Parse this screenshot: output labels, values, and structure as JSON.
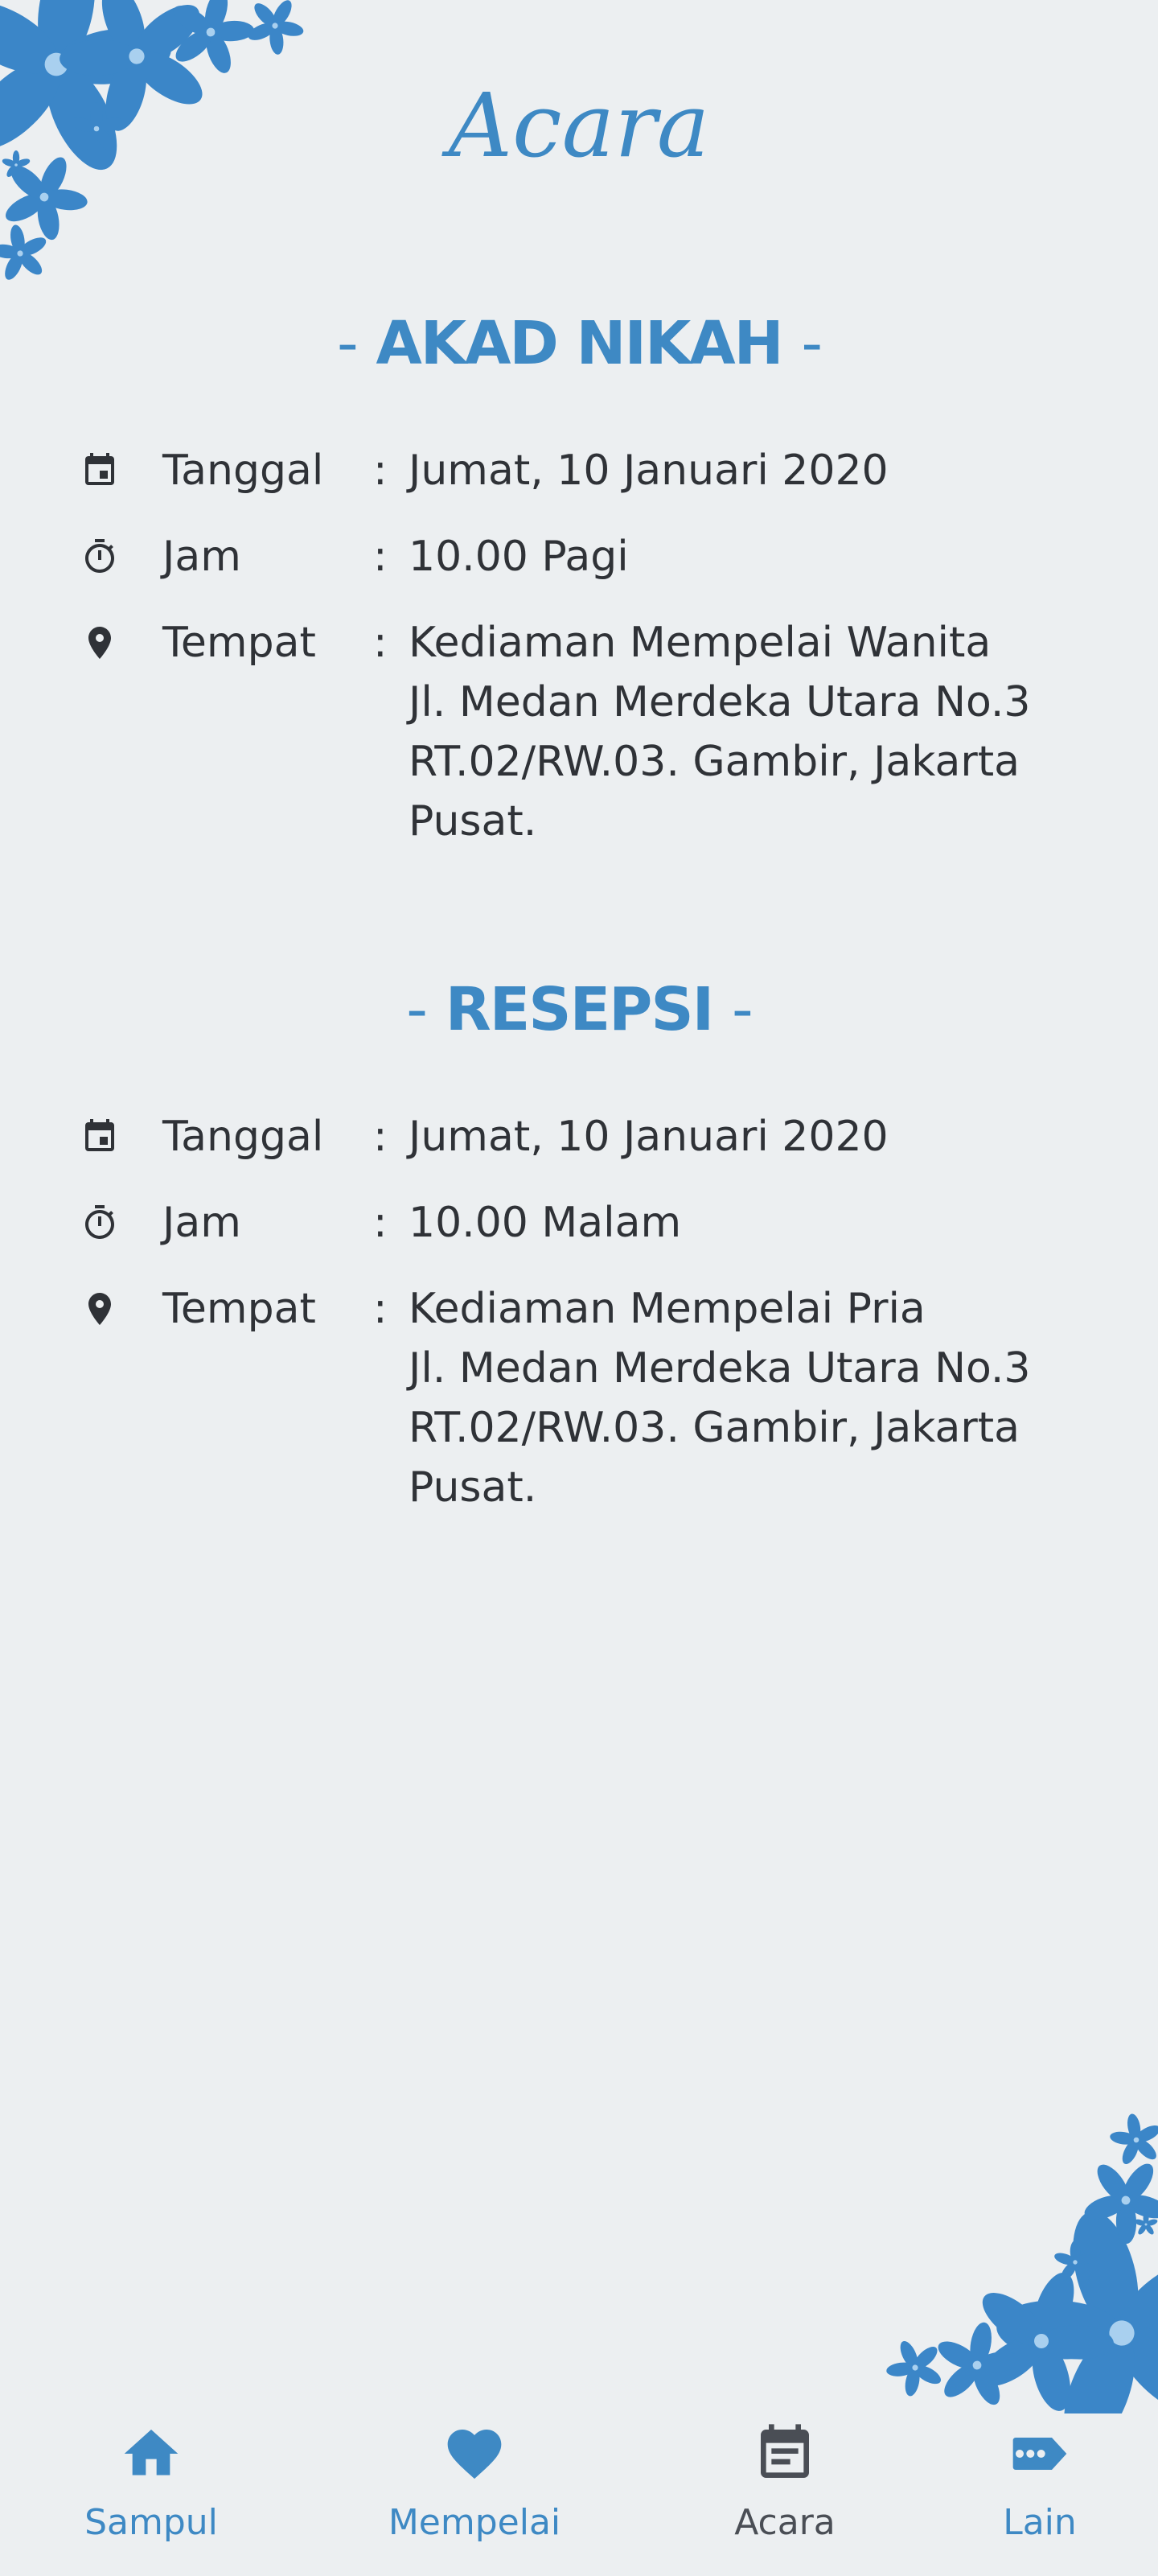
{
  "colors": {
    "background": "#eceff1",
    "accent": "#3e89c4",
    "text": "#2f3237",
    "nav_active": "#4a4e55"
  },
  "page": {
    "title": "Acara"
  },
  "sections": [
    {
      "title": "AKAD NIKAH",
      "rows": [
        {
          "icon": "calendar-icon",
          "label": "Tanggal",
          "value": "Jumat, 10 Januari 2020"
        },
        {
          "icon": "timer-icon",
          "label": "Jam",
          "value": "10.00 Pagi"
        },
        {
          "icon": "location-pin-icon",
          "label": "Tempat",
          "value": "Kediaman Mempelai Wanita\nJl. Medan Merdeka Utara No.3\nRT.02/RW.03. Gambir, Jakarta\nPusat."
        }
      ]
    },
    {
      "title": "RESEPSI",
      "rows": [
        {
          "icon": "calendar-icon",
          "label": "Tanggal",
          "value": "Jumat, 10 Januari 2020"
        },
        {
          "icon": "timer-icon",
          "label": "Jam",
          "value": "10.00 Malam"
        },
        {
          "icon": "location-pin-icon",
          "label": "Tempat",
          "value": "Kediaman Mempelai Pria\nJl. Medan Merdeka Utara No.3\nRT.02/RW.03. Gambir, Jakarta\nPusat."
        }
      ]
    }
  ],
  "separator": ":",
  "title_dash": "-",
  "nav": {
    "items": [
      {
        "label": "Sampul",
        "icon": "home-icon",
        "active": false
      },
      {
        "label": "Mempelai",
        "icon": "heart-icon",
        "active": false
      },
      {
        "label": "Acara",
        "icon": "event-note-icon",
        "active": true
      },
      {
        "label": "Lain",
        "icon": "more-chat-icon",
        "active": false
      }
    ]
  }
}
